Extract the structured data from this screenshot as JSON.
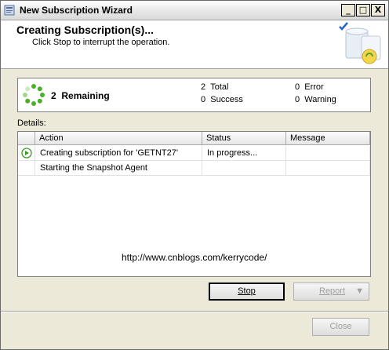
{
  "window": {
    "title": "New Subscription Wizard",
    "controls": {
      "minimize": "_",
      "maximize": "□",
      "close": "X"
    }
  },
  "header": {
    "title": "Creating Subscription(s)...",
    "subtitle": "Click Stop to interrupt the operation."
  },
  "status": {
    "remaining_count": "2",
    "remaining_label": "Remaining",
    "total_count": "2",
    "total_label": "Total",
    "success_count": "0",
    "success_label": "Success",
    "error_count": "0",
    "error_label": "Error",
    "warning_count": "0",
    "warning_label": "Warning"
  },
  "details": {
    "label": "Details:",
    "columns": [
      "Action",
      "Status",
      "Message"
    ],
    "rows": [
      {
        "action": "Creating subscription for 'GETNT27'",
        "status": "In progress...",
        "message": "",
        "icon": "in-progress-icon"
      },
      {
        "action": "Starting the Snapshot Agent",
        "status": "",
        "message": "",
        "icon": ""
      }
    ]
  },
  "watermark": "http://www.cnblogs.com/kerrycode/",
  "buttons": {
    "stop": "Stop",
    "report": "Report",
    "close": "Close"
  },
  "colors": {
    "progress_green": "#4caf2a",
    "window_bg": "#ece9d8"
  }
}
